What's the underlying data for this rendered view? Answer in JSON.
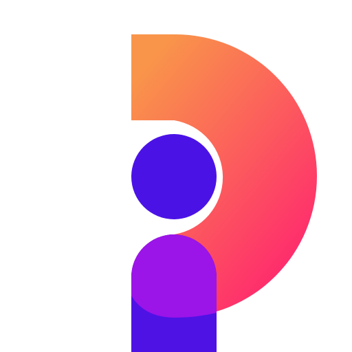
{
  "logo": {
    "icon": "letter-p-person-icon",
    "colors": {
      "background": "#ffffff",
      "gradient_start": "#F9954A",
      "gradient_end": "#FF2270",
      "dot": "#4B12E6",
      "stem": "#4E12E5",
      "overlap": "#9B14E8"
    }
  }
}
